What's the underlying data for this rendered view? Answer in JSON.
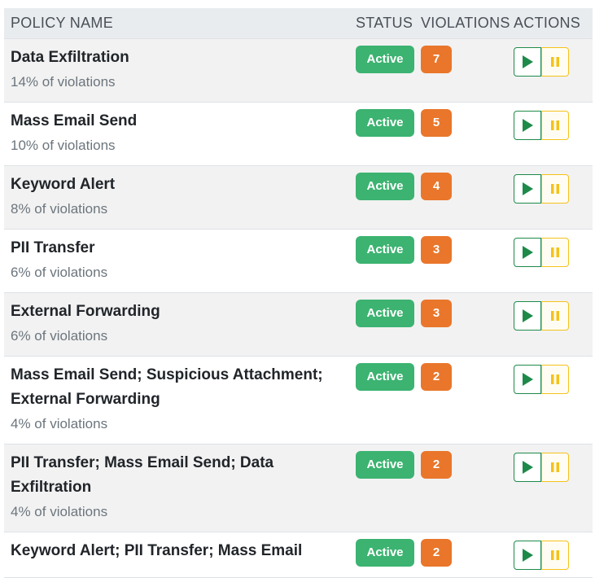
{
  "header": {
    "policy_name": "POLICY NAME",
    "status": "STATUS",
    "violations": "VIOLATIONS",
    "actions": "ACTIONS"
  },
  "rows": [
    {
      "name": "Data Exfiltration",
      "subtitle": "14% of violations",
      "status": "Active",
      "count": "7"
    },
    {
      "name": "Mass Email Send",
      "subtitle": "10% of violations",
      "status": "Active",
      "count": "5"
    },
    {
      "name": "Keyword Alert",
      "subtitle": "8% of violations",
      "status": "Active",
      "count": "4"
    },
    {
      "name": "PII Transfer",
      "subtitle": "6% of violations",
      "status": "Active",
      "count": "3"
    },
    {
      "name": "External Forwarding",
      "subtitle": "6% of violations",
      "status": "Active",
      "count": "3"
    },
    {
      "name": "Mass Email Send; Suspicious Attachment; External Forwarding",
      "subtitle": "4% of violations",
      "status": "Active",
      "count": "2"
    },
    {
      "name": "PII Transfer; Mass Email Send; Data Exfiltration",
      "subtitle": "4% of violations",
      "status": "Active",
      "count": "2"
    },
    {
      "name": "Keyword Alert; PII Transfer; Mass Email",
      "subtitle": "",
      "status": "Active",
      "count": "2"
    }
  ],
  "icons": {
    "play": "play-icon",
    "pause": "pause-icon"
  },
  "colors": {
    "active": "#3cb371",
    "count": "#e9762b",
    "play": "#1e8a4a",
    "pause": "#f4c21b"
  }
}
